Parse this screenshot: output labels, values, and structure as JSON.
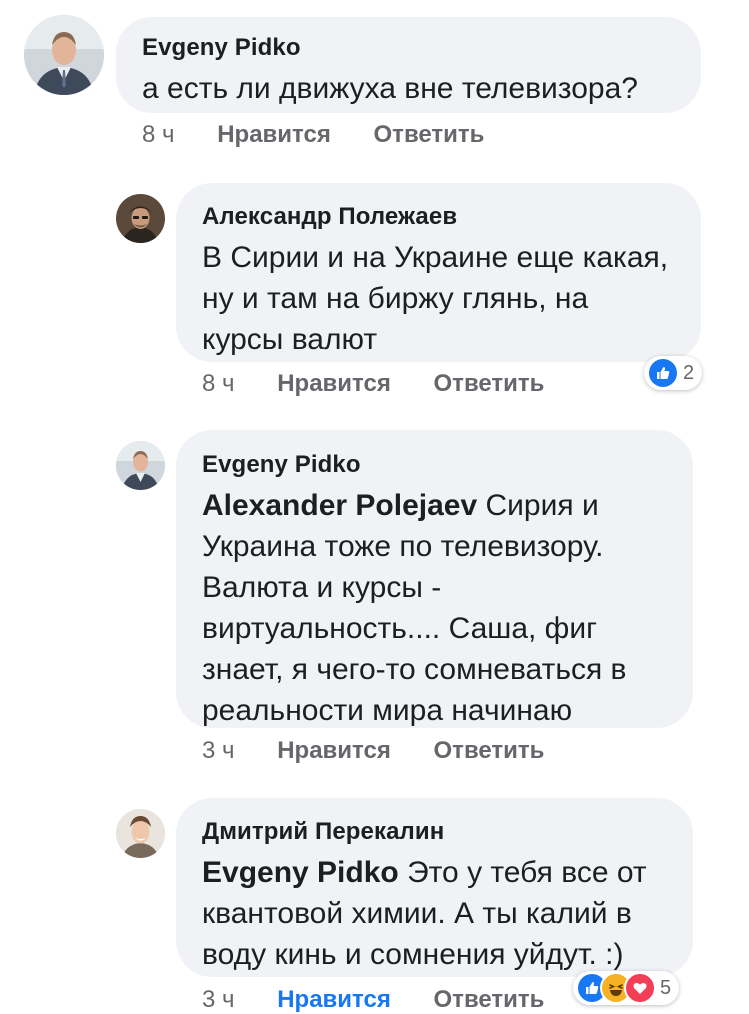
{
  "comments": [
    {
      "author": "Evgeny Pidko",
      "text": "а есть ли движуха вне телевизора?",
      "time": "8 ч",
      "like_label": "Нравится",
      "reply_label": "Ответить",
      "liked": false
    },
    {
      "author": "Александр Полежаев",
      "text": "В Сирии и на Украине еще какая, ну и там на биржу глянь, на курсы валют",
      "time": "8 ч",
      "like_label": "Нравится",
      "reply_label": "Ответить",
      "liked": false,
      "reactions": {
        "icons": [
          "like-icon"
        ],
        "count": "2"
      }
    },
    {
      "author": "Evgeny Pidko",
      "mention": "Alexander Polejaev",
      "text": "Сирия и Украина тоже по телевизору. Валюта и курсы - виртуальность.... Саша, фиг знает, я чего-то сомневаться в реальности мира начинаю",
      "time": "3 ч",
      "like_label": "Нравится",
      "reply_label": "Ответить",
      "liked": false
    },
    {
      "author": "Дмитрий Перекалин",
      "mention": "Evgeny Pidko",
      "text": "Это у тебя все от квантовой химии. А ты калий в воду кинь и сомнения уйдут. :)",
      "time": "3 ч",
      "like_label": "Нравится",
      "reply_label": "Ответить",
      "liked": true,
      "reactions": {
        "icons": [
          "like-icon",
          "haha-icon",
          "love-icon"
        ],
        "count": "5"
      }
    }
  ],
  "colors": {
    "bubble": "#f0f2f5",
    "meta_text": "#65676b",
    "like_active": "#1877f2",
    "haha": "#f7b125",
    "love": "#f33e58"
  }
}
